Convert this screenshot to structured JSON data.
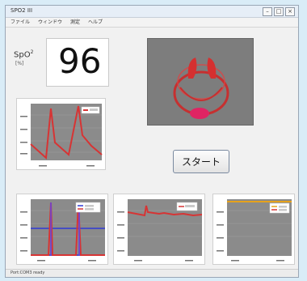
{
  "window": {
    "title": "SPO2 III",
    "controls": [
      "–",
      "□",
      "×"
    ]
  },
  "menu": [
    "ファイル",
    "ウィンドウ",
    "測定",
    "ヘルプ"
  ],
  "spo2": {
    "label": "SpO",
    "sup": "2",
    "unit": "[%]",
    "value": "96"
  },
  "start_button": "スタート",
  "status": "Port:COM3   ready",
  "colors": {
    "signal": "#d73434",
    "threshold": "#2f3bd6",
    "baseline": "#e6a21c"
  }
}
